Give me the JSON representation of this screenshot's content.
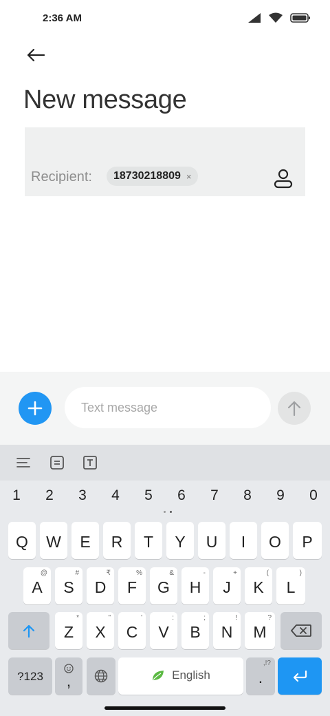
{
  "status": {
    "time": "2:36 AM"
  },
  "header": {
    "title": "New message"
  },
  "recipient": {
    "label": "Recipient:",
    "chip_number": "18730218809",
    "chip_close": "×"
  },
  "compose": {
    "placeholder": "Text message"
  },
  "keyboard": {
    "numbers": [
      "1",
      "2",
      "3",
      "4",
      "5",
      "6",
      "7",
      "8",
      "9",
      "0"
    ],
    "row1": [
      {
        "main": "Q",
        "sub": ""
      },
      {
        "main": "W",
        "sub": ""
      },
      {
        "main": "E",
        "sub": ""
      },
      {
        "main": "R",
        "sub": ""
      },
      {
        "main": "T",
        "sub": ""
      },
      {
        "main": "Y",
        "sub": ""
      },
      {
        "main": "U",
        "sub": ""
      },
      {
        "main": "I",
        "sub": ""
      },
      {
        "main": "O",
        "sub": ""
      },
      {
        "main": "P",
        "sub": ""
      }
    ],
    "row2": [
      {
        "main": "A",
        "sub": "@"
      },
      {
        "main": "S",
        "sub": "#"
      },
      {
        "main": "D",
        "sub": "₹"
      },
      {
        "main": "F",
        "sub": "%"
      },
      {
        "main": "G",
        "sub": "&"
      },
      {
        "main": "H",
        "sub": "-"
      },
      {
        "main": "J",
        "sub": "+"
      },
      {
        "main": "K",
        "sub": "("
      },
      {
        "main": "L",
        "sub": ")"
      }
    ],
    "row3": [
      {
        "main": "Z",
        "sub": "*"
      },
      {
        "main": "X",
        "sub": "\""
      },
      {
        "main": "C",
        "sub": "'"
      },
      {
        "main": "V",
        "sub": ":"
      },
      {
        "main": "B",
        "sub": ";"
      },
      {
        "main": "N",
        "sub": "!"
      },
      {
        "main": "M",
        "sub": "?"
      }
    ],
    "symbols_label": "?123",
    "comma_label": ",",
    "space_label": "English",
    "period_label": ".",
    "period_sub": ",!?"
  },
  "colors": {
    "accent": "#2196f3",
    "compose_bg": "#f4f5f5",
    "keyboard_bg": "#e8eaed"
  }
}
